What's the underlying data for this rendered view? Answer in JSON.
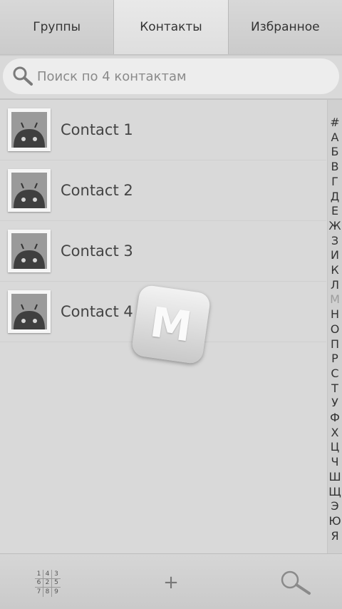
{
  "tabs": [
    {
      "label": "Группы"
    },
    {
      "label": "Контакты"
    },
    {
      "label": "Избранное"
    }
  ],
  "active_tab": "Контакты",
  "search": {
    "placeholder": "Поиск по 4 контактам",
    "icon": "search-icon"
  },
  "contacts": [
    {
      "name": "Contact 1",
      "avatar": "android-icon"
    },
    {
      "name": "Contact 2",
      "avatar": "android-icon"
    },
    {
      "name": "Contact 3",
      "avatar": "android-icon"
    },
    {
      "name": "Contact 4",
      "avatar": "android-icon"
    }
  ],
  "index_letters": [
    "#",
    "А",
    "Б",
    "В",
    "Г",
    "Д",
    "Е",
    "Ж",
    "З",
    "И",
    "К",
    "Л",
    "М",
    "Н",
    "О",
    "П",
    "Р",
    "С",
    "Т",
    "У",
    "Ф",
    "Х",
    "Ц",
    "Ч",
    "Ш",
    "Щ",
    "Э",
    "Ю",
    "Я"
  ],
  "index_selected": "М",
  "popup_letter": "M",
  "bottom_bar": {
    "dialpad_digits": [
      "1",
      "4",
      "3",
      "6",
      "2",
      "5",
      "7",
      "8",
      "9"
    ],
    "add_label": "+",
    "search_icon": "search-icon"
  },
  "colors": {
    "background": "#d9d9d9",
    "tab_active": "#e4e4e4",
    "text": "#444444"
  }
}
